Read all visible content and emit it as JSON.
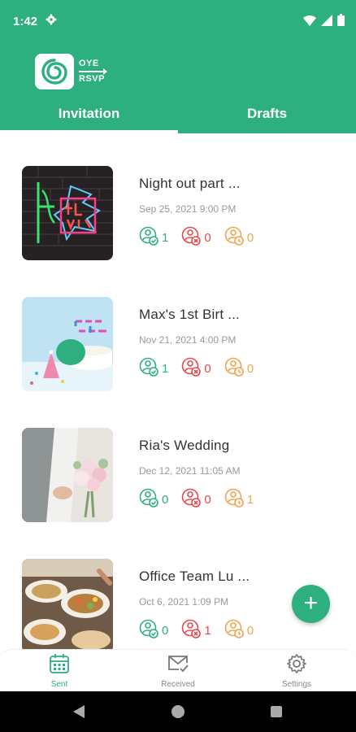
{
  "status_bar": {
    "time": "1:42"
  },
  "logo": {
    "line1": "OYE",
    "line2": "RSVP"
  },
  "tabs": [
    {
      "label": "Invitation",
      "active": true
    },
    {
      "label": "Drafts",
      "active": false
    }
  ],
  "events": [
    {
      "title": "Night out part ...",
      "date": "Sep 25, 2021 9:00 PM",
      "accepted": "1",
      "declined": "0",
      "pending": "0"
    },
    {
      "title": "Max's 1st Birt ...",
      "date": "Nov 21, 2021 4:00 PM",
      "accepted": "1",
      "declined": "0",
      "pending": "0"
    },
    {
      "title": "Ria's Wedding",
      "date": "Dec 12, 2021 11:05 AM",
      "accepted": "0",
      "declined": "0",
      "pending": "1"
    },
    {
      "title": "Office Team Lu ...",
      "date": "Oct 6, 2021 1:09 PM",
      "accepted": "0",
      "declined": "1",
      "pending": "0"
    }
  ],
  "fab": {
    "label": "+"
  },
  "bottom_nav": [
    {
      "label": "Sent",
      "active": true
    },
    {
      "label": "Received",
      "active": false
    },
    {
      "label": "Settings",
      "active": false
    }
  ],
  "colors": {
    "brand": "#2daf7f",
    "accepted": "#2daf7f",
    "declined": "#e8474c",
    "pending": "#f2a34b"
  }
}
